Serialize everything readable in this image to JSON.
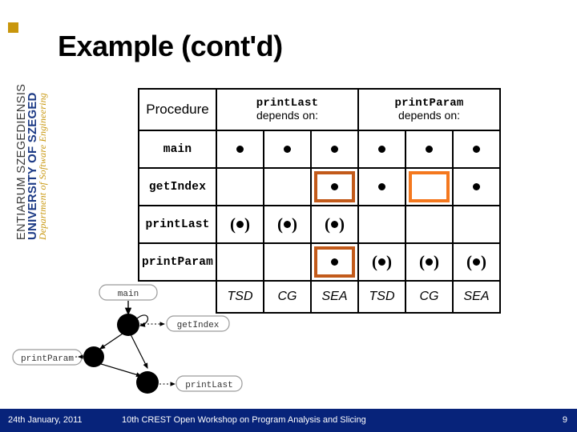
{
  "slide": {
    "title": "Example (cont'd)"
  },
  "sidebar": {
    "line1": "ENTIARUM SZEGEDIENSIS",
    "line2": "UNIVERSITY OF SZEGED",
    "line3": "Department of Software Engineering",
    "logo_color": "#c8960c"
  },
  "table": {
    "headers": {
      "procedure": "Procedure",
      "group1_name": "printLast",
      "group1_sub": "depends on:",
      "group2_name": "printParam",
      "group2_sub": "depends on:"
    },
    "rows": [
      {
        "procedure": "main",
        "cells": [
          {
            "mark": "dot",
            "highlight": "none"
          },
          {
            "mark": "dot",
            "highlight": "none"
          },
          {
            "mark": "dot",
            "highlight": "none"
          },
          {
            "mark": "dot",
            "highlight": "none"
          },
          {
            "mark": "dot",
            "highlight": "none"
          },
          {
            "mark": "dot",
            "highlight": "none"
          }
        ]
      },
      {
        "procedure": "getIndex",
        "cells": [
          {
            "mark": "none",
            "highlight": "none"
          },
          {
            "mark": "none",
            "highlight": "none"
          },
          {
            "mark": "dot",
            "highlight": "dark"
          },
          {
            "mark": "dot",
            "highlight": "none"
          },
          {
            "mark": "none",
            "highlight": "bright"
          },
          {
            "mark": "dot",
            "highlight": "none"
          }
        ]
      },
      {
        "procedure": "printLast",
        "cells": [
          {
            "mark": "paren-dot",
            "highlight": "none"
          },
          {
            "mark": "paren-dot",
            "highlight": "none"
          },
          {
            "mark": "paren-dot",
            "highlight": "none"
          },
          {
            "mark": "none",
            "highlight": "none"
          },
          {
            "mark": "none",
            "highlight": "none"
          },
          {
            "mark": "none",
            "highlight": "none"
          }
        ]
      },
      {
        "procedure": "printParam",
        "cells": [
          {
            "mark": "none",
            "highlight": "none"
          },
          {
            "mark": "none",
            "highlight": "none"
          },
          {
            "mark": "dot",
            "highlight": "dark"
          },
          {
            "mark": "paren-dot",
            "highlight": "none"
          },
          {
            "mark": "paren-dot",
            "highlight": "none"
          },
          {
            "mark": "paren-dot",
            "highlight": "none"
          }
        ]
      }
    ],
    "footer_labels": [
      "TSD",
      "CG",
      "SEA",
      "TSD",
      "CG",
      "SEA"
    ],
    "highlight_colors": {
      "dark": "#c25a1a",
      "bright": "#f4781e"
    }
  },
  "callgraph": {
    "nodes": [
      {
        "id": "main",
        "label": "main"
      },
      {
        "id": "getIndex",
        "label": "getIndex"
      },
      {
        "id": "printParam",
        "label": "printParam"
      },
      {
        "id": "printLast",
        "label": "printLast"
      }
    ]
  },
  "footer": {
    "date": "24th January, 2011",
    "center": "10th CREST Open Workshop on Program Analysis and Slicing",
    "page": "9",
    "bar_color": "#07237a"
  }
}
